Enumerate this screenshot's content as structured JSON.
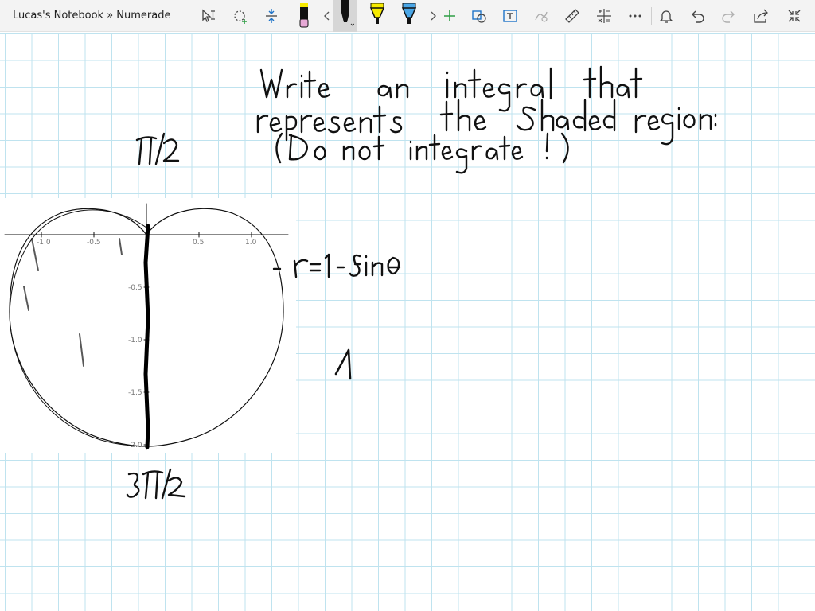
{
  "window": {
    "title": "Lucas's Notebook » Numerade"
  },
  "toolbar": {
    "tools": [
      {
        "name": "lasso-select-icon"
      },
      {
        "name": "add-shape-icon"
      },
      {
        "name": "insert-space-icon"
      },
      {
        "name": "pen-pink-icon",
        "color": "#e7a9d6"
      },
      {
        "name": "pen-black-icon",
        "color": "#111111"
      },
      {
        "name": "highlighter-yellow-icon",
        "color": "#f6ea00"
      },
      {
        "name": "highlighter-blue-icon",
        "color": "#4aa6e6"
      },
      {
        "name": "add-pen-icon"
      },
      {
        "name": "ink-to-shape-icon"
      },
      {
        "name": "ink-to-text-icon"
      },
      {
        "name": "ink-to-math-icon"
      },
      {
        "name": "ruler-icon"
      },
      {
        "name": "math-icon"
      },
      {
        "name": "more-icon"
      },
      {
        "name": "bell-icon"
      },
      {
        "name": "undo-icon"
      },
      {
        "name": "redo-icon"
      },
      {
        "name": "share-icon"
      },
      {
        "name": "collapse-icon"
      }
    ]
  },
  "graph": {
    "x_tick_labels": [
      "-1.0",
      "-0.5",
      "0.5",
      "1.0"
    ],
    "y_tick_labels": [
      "-0.5",
      "-1.0",
      "-1.5",
      "-2.0"
    ],
    "shade_color": "#a9d5f5",
    "curve_color": "#5a6f90"
  }
}
